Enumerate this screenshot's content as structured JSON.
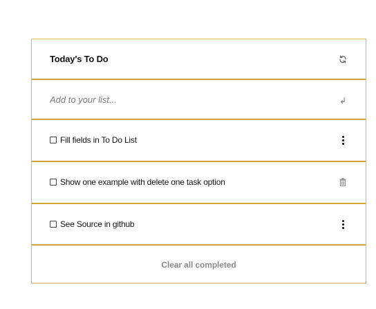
{
  "header": {
    "title": "Today's To Do",
    "refresh_icon": "refresh-icon"
  },
  "input": {
    "placeholder": "Add to your list...",
    "enter_icon": "enter-icon",
    "enter_glyph": "↲"
  },
  "tasks": [
    {
      "label": "Fill fields in To Do List",
      "checked": false,
      "action_icon": "more-vertical-icon"
    },
    {
      "label": "Show one example with delete one task option",
      "checked": false,
      "action_icon": "trash-icon"
    },
    {
      "label": "See Source in github",
      "checked": false,
      "action_icon": "more-vertical-icon"
    }
  ],
  "footer": {
    "clear_label": "Clear all completed"
  },
  "colors": {
    "border": "#d3a43b",
    "text": "#111111",
    "muted": "#8a8a8a"
  }
}
